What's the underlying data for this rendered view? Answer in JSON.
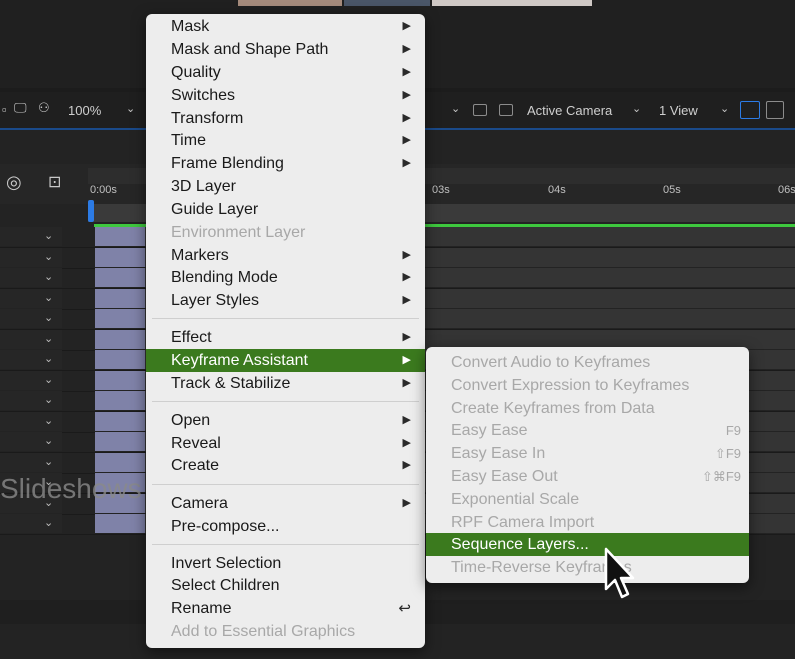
{
  "toolbar": {
    "zoom": "100%",
    "view_camera": "Active Camera",
    "view_count": "1 View"
  },
  "timeline": {
    "ticks": [
      "0:00s",
      "03s",
      "04s",
      "05s",
      "06s"
    ]
  },
  "watermark_text": "Slideshows",
  "context_menu": {
    "items": [
      {
        "label": "Mask",
        "submenu": true,
        "disabled": false
      },
      {
        "label": "Mask and Shape Path",
        "submenu": true,
        "disabled": false
      },
      {
        "label": "Quality",
        "submenu": true,
        "disabled": false
      },
      {
        "label": "Switches",
        "submenu": true,
        "disabled": false
      },
      {
        "label": "Transform",
        "submenu": true,
        "disabled": false
      },
      {
        "label": "Time",
        "submenu": true,
        "disabled": false
      },
      {
        "label": "Frame Blending",
        "submenu": true,
        "disabled": false
      },
      {
        "label": "3D Layer",
        "submenu": false,
        "disabled": false
      },
      {
        "label": "Guide Layer",
        "submenu": false,
        "disabled": false
      },
      {
        "label": "Environment Layer",
        "submenu": false,
        "disabled": true
      },
      {
        "label": "Markers",
        "submenu": true,
        "disabled": false
      },
      {
        "label": "Blending Mode",
        "submenu": true,
        "disabled": false
      },
      {
        "label": "Layer Styles",
        "submenu": true,
        "disabled": false
      },
      {
        "label": "Effect",
        "submenu": true,
        "disabled": false
      },
      {
        "label": "Keyframe Assistant",
        "submenu": true,
        "disabled": false,
        "selected": true
      },
      {
        "label": "Track & Stabilize",
        "submenu": true,
        "disabled": false
      },
      {
        "label": "Open",
        "submenu": true,
        "disabled": false
      },
      {
        "label": "Reveal",
        "submenu": true,
        "disabled": false
      },
      {
        "label": "Create",
        "submenu": true,
        "disabled": false
      },
      {
        "label": "Camera",
        "submenu": true,
        "disabled": false
      },
      {
        "label": "Pre-compose...",
        "submenu": false,
        "disabled": false
      },
      {
        "label": "Invert Selection",
        "submenu": false,
        "disabled": false
      },
      {
        "label": "Select Children",
        "submenu": false,
        "disabled": false
      },
      {
        "label": "Rename",
        "submenu": false,
        "disabled": false,
        "shortcut": "↩"
      },
      {
        "label": "Add to Essential Graphics",
        "submenu": false,
        "disabled": true
      }
    ]
  },
  "submenu": {
    "items": [
      {
        "label": "Convert Audio to Keyframes",
        "disabled": true,
        "shortcut": ""
      },
      {
        "label": "Convert Expression to Keyframes",
        "disabled": true,
        "shortcut": ""
      },
      {
        "label": "Create Keyframes from Data",
        "disabled": true,
        "shortcut": ""
      },
      {
        "label": "Easy Ease",
        "disabled": true,
        "shortcut": "F9"
      },
      {
        "label": "Easy Ease In",
        "disabled": true,
        "shortcut": "⇧F9"
      },
      {
        "label": "Easy Ease Out",
        "disabled": true,
        "shortcut": "⇧⌘F9"
      },
      {
        "label": "Exponential Scale",
        "disabled": true,
        "shortcut": ""
      },
      {
        "label": "RPF Camera Import",
        "disabled": true,
        "shortcut": ""
      },
      {
        "label": "Sequence Layers...",
        "disabled": false,
        "selected": true,
        "shortcut": ""
      },
      {
        "label": "Time-Reverse Keyframes",
        "disabled": true,
        "shortcut": ""
      }
    ]
  },
  "colors": {
    "selection": "#3b7a1e",
    "menu_bg": "#ededed",
    "accent_blue": "#2c7be5",
    "work_green": "#3ec83e"
  }
}
